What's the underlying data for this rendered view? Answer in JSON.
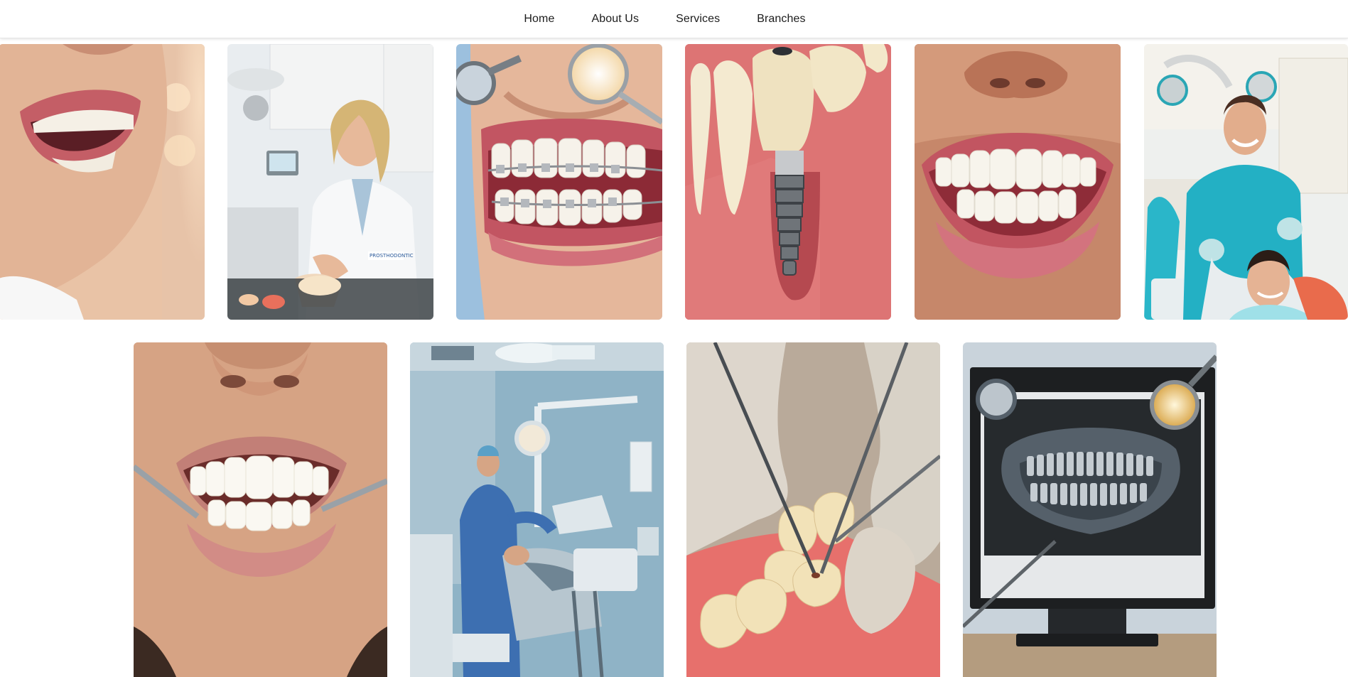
{
  "nav": {
    "items": [
      {
        "label": "Home"
      },
      {
        "label": "About Us"
      },
      {
        "label": "Services"
      },
      {
        "label": "Branches"
      }
    ]
  },
  "gallery": {
    "row1": [
      {
        "name": "smile-photo"
      },
      {
        "name": "prosthodontist-photo",
        "coat_text": "PROSTHODONTIC"
      },
      {
        "name": "braces-photo"
      },
      {
        "name": "implant-photo"
      },
      {
        "name": "teeth-closeup-photo"
      },
      {
        "name": "dentist-patient-photo"
      }
    ],
    "row2": [
      {
        "name": "dental-exam-photo"
      },
      {
        "name": "dental-surgery-room-photo"
      },
      {
        "name": "dental-procedure-photo"
      },
      {
        "name": "dental-xray-photo"
      }
    ]
  },
  "colors": {
    "nav_text": "#1c1c1c",
    "gum": "#d9858a",
    "tooth": "#f6f1e6",
    "scrubs_teal": "#2ab6c9",
    "clinic_blue": "#8fb3c6"
  }
}
